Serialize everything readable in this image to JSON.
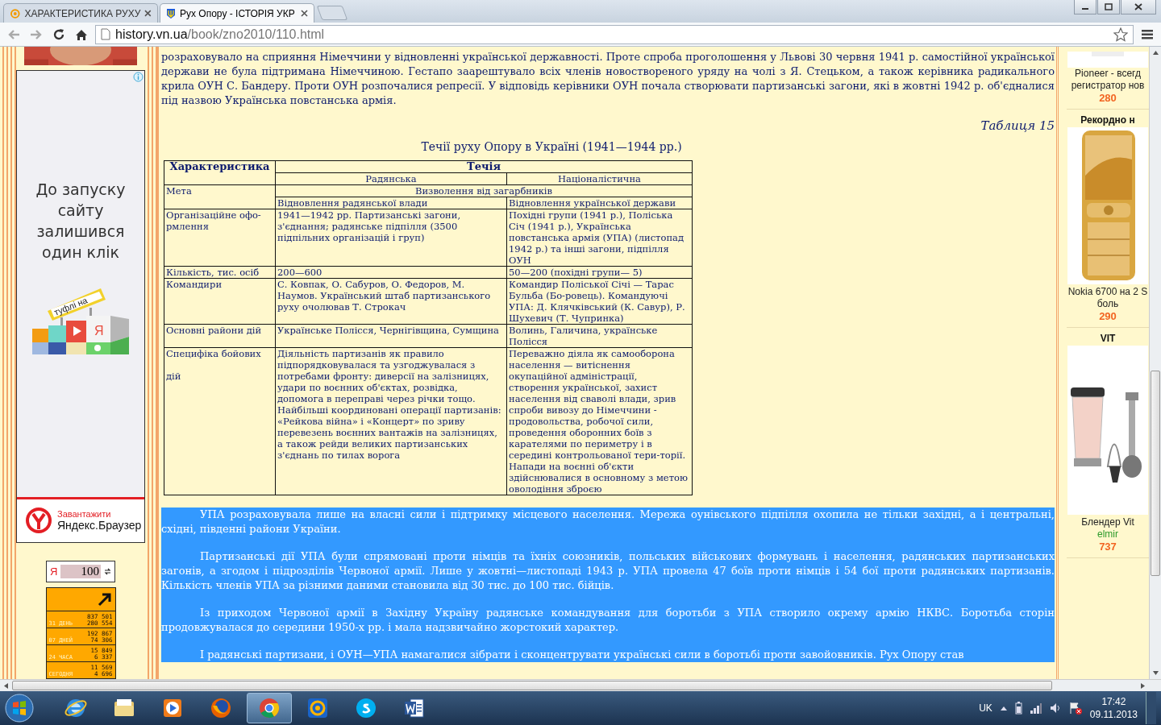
{
  "browser": {
    "tabs": [
      {
        "title": "ХАРАКТЕРИСТИКА РУХУ",
        "selected": false
      },
      {
        "title": "Рух Опору - ІСТОРІЯ УКР",
        "selected": true
      }
    ],
    "address": {
      "host": "history.vn.ua",
      "path": "/book/zno2010/110.html"
    }
  },
  "left_sidebar": {
    "ad": {
      "headline": "До запуску сайту залишився один клік",
      "sign": "туфлі на",
      "letter": "Я",
      "cta": "Завантажити",
      "brand": "Яндекс.Браузер"
    },
    "money_widget": {
      "letter": "Я",
      "amount": "100"
    },
    "counter": [
      {
        "label": "31 ДЕНЬ",
        "values": [
          "837 501",
          "280 554"
        ]
      },
      {
        "label": "07 ДНЕЙ",
        "values": [
          "192 867",
          "74 306"
        ]
      },
      {
        "label": "24 ЧАСА",
        "values": [
          "15 849",
          "6 337"
        ]
      },
      {
        "label": "СЕГОДНЯ",
        "values": [
          "11 569",
          "4 696"
        ]
      }
    ]
  },
  "article": {
    "intro": "розраховувало на сприяння Німеччини у відновленні української державності. Проте спроба проголошення у Львові 30 червня 1941 р. самостійної української держави не була підтримана Німеччиною. Гестапо заарештувало всіх членів новоствореного уряду на чолі з Я. Стецьком, а також керівника радикального крила ОУН С. Бандеру. Проти ОУН розпочалися репресії. У відповідь керівники ОУН почала створювати партизанські загони, які в жовтні 1942 р. об'єдналися під назвою Українська повстанська армія.",
    "table_number": "Таблиця 15",
    "table_caption": "Течії руху Опору в Україні (1941—1944 рр.)",
    "table": {
      "corner": "Характеристика",
      "group": "Течія",
      "columns": [
        "Радянська",
        "Націоналістична"
      ],
      "goal": {
        "label": "Мета",
        "common": "Визволення від загарбників",
        "values": [
          "Відновлення радянської влади",
          "Відновлення української держави"
        ]
      },
      "rows": [
        {
          "label": "Організаційне офо-\nрмлення",
          "cells": [
            "1941—1942 рр. Партизанські загони, з'єднання; радянське підпілля (3500 підпільних організацій і груп)",
            "Похідні групи (1941 р.), Поліська Січ (1941 р.), Українська повстанська армія (УПА) (листопад 1942 р.) та інші загони, підпілля ОУН"
          ]
        },
        {
          "label": "Кількість, тис. осіб",
          "cells": [
            "200—600",
            "50—200 (похідні групи— 5)"
          ]
        },
        {
          "label": "Командири",
          "cells": [
            "С. Ковпак, О. Сабуров, О. Федоров, М. Наумов. Український штаб партизанського руху очолював Т. Строкач",
            "Командир Поліської Січі — Тарас Бульба (Бо-ровець). Командуючі УПА: Д. Клячківський (К. Савур), Р. Шухевич (Т. Чупринка)"
          ]
        },
        {
          "label": "Основні райони дій",
          "cells": [
            "Українське Полісся, Чернігівщина, Сумщина",
            "Волинь, Галичина, українське Полісся"
          ]
        },
        {
          "label": "Специфіка бойових\n\nдій",
          "cells": [
            "Діяльність партизанів як правило підпорядковувалася та узгоджувалася з потребами фронту: диверсії на залізницях, удари по воєнних об'єктах, розвідка, допомога в переправі через річки тощо. Найбільші координовані операції партизанів: «Рейкова війна» і «Концерт» по зриву перевезень воєнних вантажів на залізницях, а також рейди великих партизанських з'єднань по тилах ворога",
            "Переважно діяла як самооборона населення — витіснення окупаційної адміністрації, створення української, захист населення від сваволі влади, зрив спроби вивозу до Німеччини - продовольства, робочої сили, проведення оборонних боїв з карателями по периметру і в середині контрольованої тери-торії. Напади на воєнні об'єкти здійснювалися в основному з метою оволодіння зброєю"
          ]
        }
      ]
    },
    "paragraphs": [
      {
        "text": "УПА розраховувала лише на власні сили і підтримку місцевого населення. Мережа оунівського підпілля охопила не тільки західні, а і центральні, східні, південні райони України.",
        "highlighted": true
      },
      {
        "text": "Партизанські дії УПА були спрямовані проти німців та їхніх союзників, польських військових формувань і населення, радянських партизанських загонів, а згодом і підрозділів Червоної армії. Лише у жовтні—листопаді 1943 р. УПА провела 47 боїв проти німців і 54 бої проти радянських партизанів. Кількість членів УПА за різними даними становила від 30 тис. до 100 тис. бійців.",
        "highlighted": true
      },
      {
        "text": "Із приходом Червоної армії в Західну Україну радянське командування для боротьби з УПА створило окрему армію НКВС. Боротьба сторін продовжувалася до середини 1950-х рр. і мала надзвичайно жорстокий характер.",
        "highlighted": true
      },
      {
        "text": "І радянські партизани, і ОУН—УПА намагалися зібрати і сконцентрувати українські сили в боротьбі проти завойовників. Рух Опору став",
        "highlighted": true
      }
    ]
  },
  "right_sidebar": {
    "products": [
      {
        "kind": "cut",
        "lines": [
          "Pioneer - всегд",
          "регистратор нов"
        ],
        "price": "280"
      },
      {
        "kind": "phone",
        "heading": "Рекордно н",
        "lines": [
          "Nokia 6700 на 2 S",
          "боль"
        ],
        "price": "290"
      },
      {
        "kind": "blender",
        "heading": "VIT",
        "lines": [
          "Блендер Vit"
        ],
        "seller": "elmir",
        "price": "737"
      }
    ]
  },
  "taskbar": {
    "apps": [
      {
        "kind": "ie",
        "selected": false
      },
      {
        "kind": "folder",
        "selected": false
      },
      {
        "kind": "player",
        "selected": false
      },
      {
        "kind": "firefox",
        "selected": false
      },
      {
        "kind": "chrome",
        "selected": true
      },
      {
        "kind": "mail",
        "selected": false
      },
      {
        "kind": "skype",
        "selected": false
      },
      {
        "kind": "word",
        "selected": false
      }
    ],
    "language": "UK",
    "time": "17:42",
    "date": "09.11.2013"
  }
}
